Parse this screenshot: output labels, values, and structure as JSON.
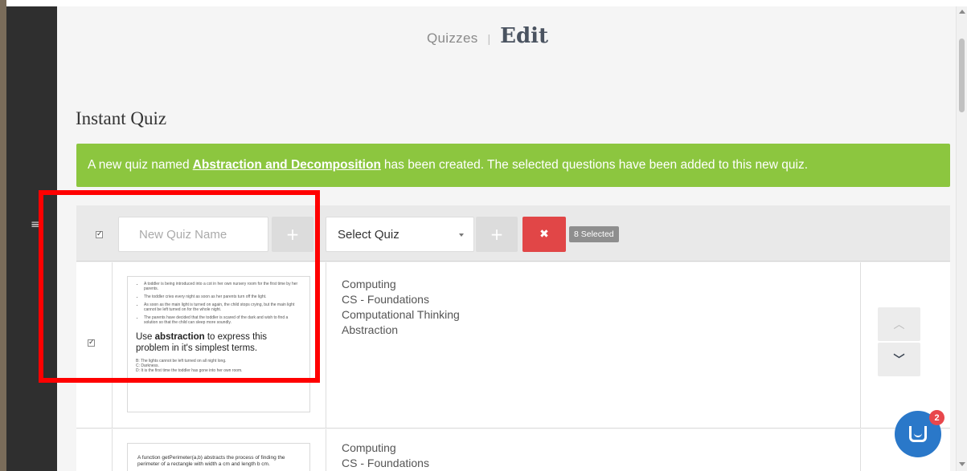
{
  "breadcrumb": {
    "parent": "Quizzes",
    "separator": "|",
    "current": "Edit"
  },
  "section_title": "Instant Quiz",
  "alert": {
    "prefix": "A new quiz named",
    "quiz_link": "Abstraction and Decomposition",
    "suffix": "has been created. The selected questions have been added to this new quiz.",
    "color": "#8cc63f"
  },
  "toolbar": {
    "select_all_checked": true,
    "new_quiz_placeholder": "New Quiz Name",
    "add_new_icon": "plus-star-icon",
    "select_quiz_value": "Select Quiz",
    "add_icon": "plus-icon",
    "delete_icon": "close-icon",
    "delete_color": "#e14647",
    "selected_badge": "8 Selected"
  },
  "questions": [
    {
      "checked": true,
      "bullets": [
        "A toddler is being introduced into a cot in her own nursery room for the first time by her parents.",
        "The toddler cries every night as soon as her parents turn off the light.",
        "As soon as the main light is turned on again, the child stops crying, but the main light cannot be left turned on for the whole night.",
        "The parents have decided that the toddler is scared of the dark and wish to find a solution so that the child can sleep more soundly."
      ],
      "question_pre": "Use",
      "question_bold": "abstraction",
      "question_post": "to express this problem in it's simplest terms.",
      "answers": [
        "B: The lights cannot be left turned on all night long.",
        "C: Darkness.",
        "D: It is the first time the toddler has gone into her own room."
      ],
      "tags": [
        "Computing",
        "CS - Foundations",
        "Computational Thinking",
        "Abstraction"
      ],
      "up_icon": "chevron-up-icon",
      "down_icon": "chevron-down-icon"
    },
    {
      "text": "A function getPerimeter(a,b) abstracts the process of finding the perimeter of a rectangle with width a cm and length b cm.",
      "tags": [
        "Computing",
        "CS - Foundations"
      ]
    }
  ],
  "chat": {
    "icon": "chat-icon",
    "badge": "2",
    "color": "#2a78c9"
  },
  "sidebar": {
    "toggle_icon": "menu-icon"
  },
  "highlight_color": "#ff0000"
}
